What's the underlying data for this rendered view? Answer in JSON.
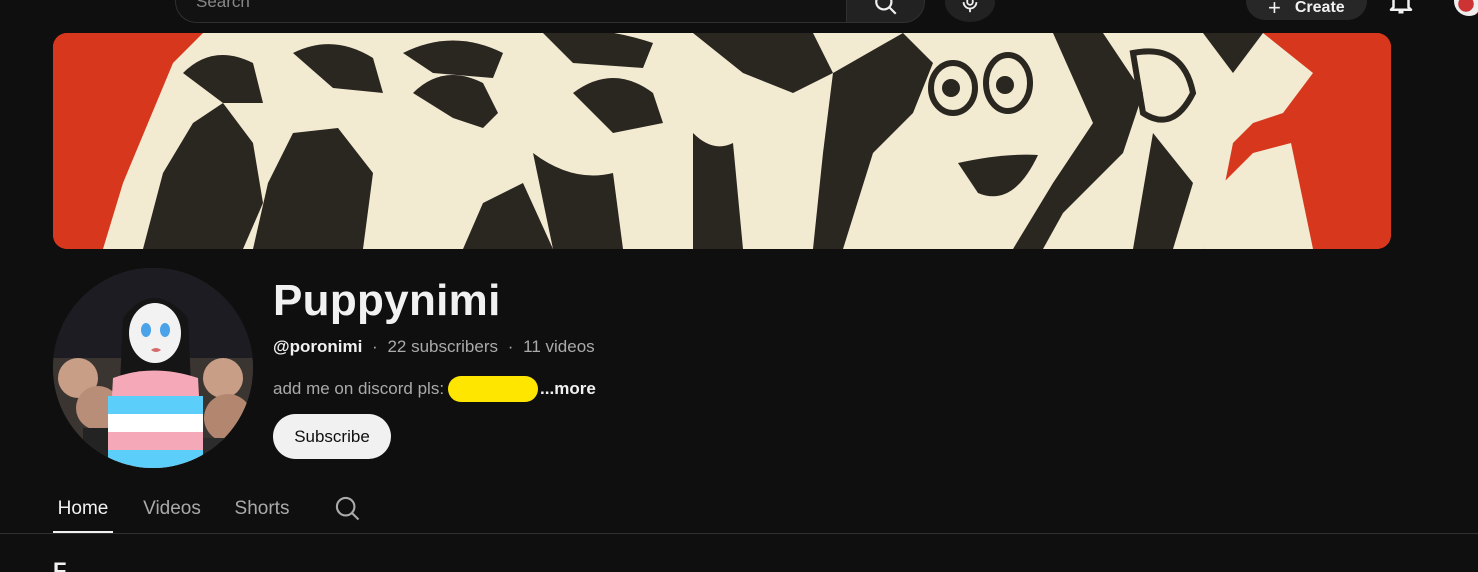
{
  "topbar": {
    "search_placeholder": "Search",
    "create_label": "Create",
    "create_icon": "plus-icon"
  },
  "channel": {
    "name": "Puppynimi",
    "handle": "@poronimi",
    "subscribers": "22 subscribers",
    "videos": "11 videos",
    "separator": "·",
    "description": "add me on discord pls:",
    "more_label": "...more",
    "subscribe_label": "Subscribe"
  },
  "tabs": [
    {
      "label": "Home",
      "active": true
    },
    {
      "label": "Videos",
      "active": false
    },
    {
      "label": "Shorts",
      "active": false
    }
  ],
  "section": {
    "heading_partial": "F"
  },
  "colors": {
    "background": "#0f0f0f",
    "banner_red": "#d7381d",
    "banner_cream": "#f3ead2",
    "banner_ink": "#2a2620",
    "redaction_yellow": "#ffe600",
    "subscribe_bg": "#f1f1f1",
    "text_primary": "#f1f1f1",
    "text_secondary": "#aaaaaa"
  }
}
